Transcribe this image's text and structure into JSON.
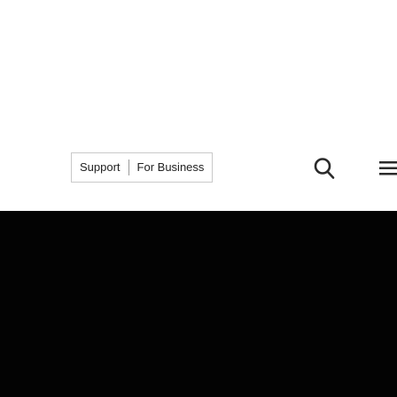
{
  "nav": {
    "links": [
      {
        "label": "Support"
      },
      {
        "label": "For Business"
      }
    ],
    "search_icon": "search-icon",
    "menu_icon": "hamburger-menu-icon"
  },
  "colors": {
    "page_background": "#ffffff",
    "hero_background": "#030303",
    "text": "#222222",
    "border": "#c9c9c9"
  }
}
